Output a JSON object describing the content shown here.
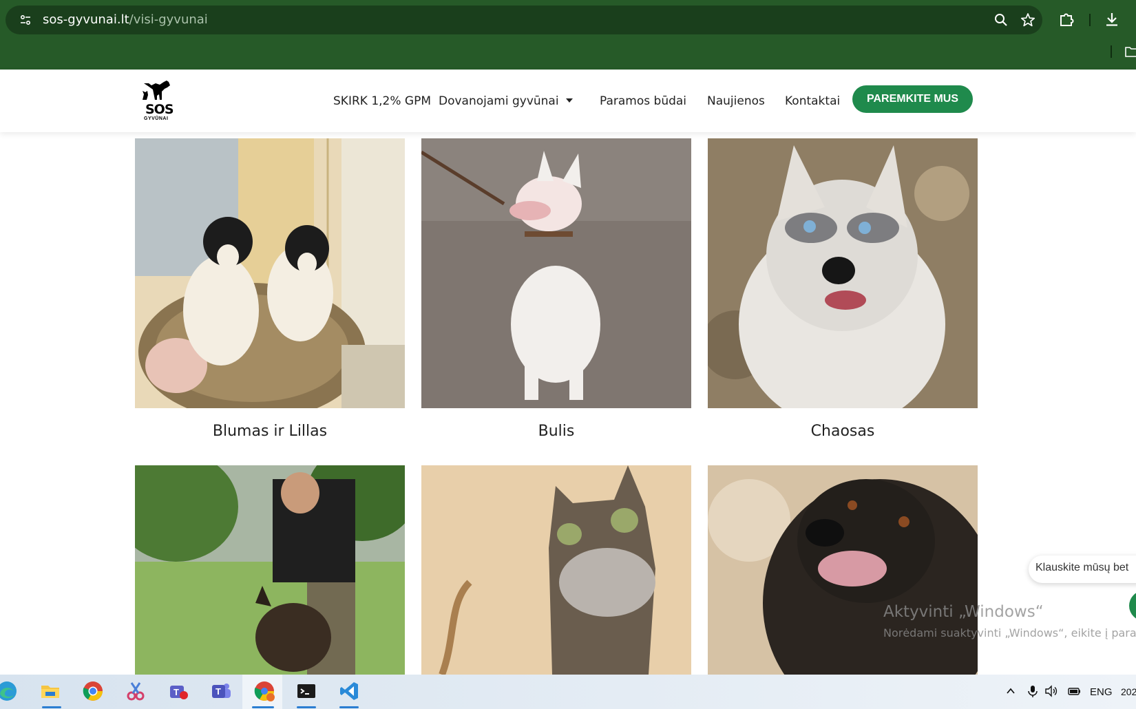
{
  "browser": {
    "url_domain": "sos-gyvunai.lt",
    "url_path": "/visi-gyvunai",
    "icons": [
      "tune-icon",
      "zoom-icon",
      "star-icon",
      "extensions-icon",
      "download-icon",
      "folder-icon"
    ],
    "theme_color": "#265a28"
  },
  "site": {
    "logo_text": "SOS",
    "logo_sub": "GYVŪNAI",
    "nav": [
      "SKIRK 1,2% GPM",
      "Dovanojami gyvūnai",
      "Paramos būdai",
      "Naujienos",
      "Kontaktai"
    ],
    "cta": "PAREMKITE MUS",
    "accent_color": "#1f8a4c"
  },
  "animals": [
    {
      "name": "Blumas ir Lillas",
      "image": "two-black-white-puppies-in-basket"
    },
    {
      "name": "Bulis",
      "image": "white-bull-terrier-on-leash"
    },
    {
      "name": "Chaosas",
      "image": "husky-blue-eyes"
    },
    {
      "name": "",
      "image": "man-with-shepherd-dog"
    },
    {
      "name": "",
      "image": "tabby-cat-silhouette-frame"
    },
    {
      "name": "",
      "image": "black-long-haired-dog"
    }
  ],
  "chat": {
    "text": "Klauskite mūsų bet"
  },
  "windows_watermark": {
    "title": "Aktyvinti „Windows“",
    "subtitle": "Norėdami suaktyvinti „Windows“, eikite į paran"
  },
  "taskbar": {
    "apps": [
      "edge-icon",
      "file-explorer-icon",
      "chrome-icon",
      "snipping-tool-icon",
      "teams-classic-icon",
      "teams-icon",
      "chrome-profile-icon",
      "terminal-icon",
      "vscode-icon"
    ],
    "language": "ENG",
    "time_fragment": "202"
  }
}
